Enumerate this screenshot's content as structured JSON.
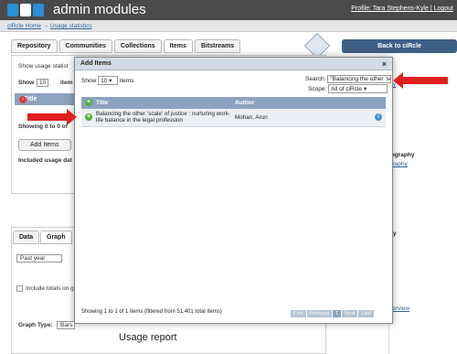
{
  "header": {
    "app_title": "admin modules",
    "profile": "Profile: Tara Stephens-Kyle | Logout"
  },
  "breadcrumb": {
    "home": "ciRcle Home",
    "sep": "→",
    "current": "Usage statistics"
  },
  "tabs": [
    "Repository",
    "Communities",
    "Collections",
    "Items",
    "Bitstreams"
  ],
  "back_button": "Back to ciRcle",
  "background": {
    "show_usage": "Show usage statist",
    "show_label": "Show",
    "show_value": "10",
    "items_label": "item",
    "th_title": "Title",
    "showing": "Showing 0 to 0 of",
    "add_items": "Add Items",
    "included": "Included usage dat",
    "data_tab": "Data",
    "graph_tab": "Graph",
    "past_year": "Past year",
    "include_totals": "Include totals on gr",
    "graph_type_label": "Graph Type:",
    "graph_type_value": "Bars",
    "usage_report": "Usage report",
    "side_bibliography": "iography",
    "side_link1": "graphy",
    "side_link2": "try",
    "side_item1": "n",
    "side_item2": "ity",
    "side_item3": "s",
    "side_item4": "verview"
  },
  "modal": {
    "title": "Add Items",
    "close": "×",
    "show_label": "Show",
    "show_value": "10",
    "items_label": "items",
    "search_label": "Search:",
    "search_value": "\"Balancing the other 'scale' of justice\"",
    "scope_label": "Scope:",
    "scope_value": "All of ciRcle",
    "col_title": "Title",
    "col_author": "Author",
    "rows": [
      {
        "title": "Balancing the other 'scale' of justice : nurturing work-life balance in the legal profession",
        "author": "Mohan, Arun"
      }
    ],
    "footer_info": "Showing 1 to 1 of 1 items (filtered from 51,401 total items)",
    "pager": [
      "First",
      "Previous",
      "1",
      "Next",
      "Last"
    ]
  },
  "colors": {
    "header": "#4a4a4a",
    "accent": "#2a8fd6",
    "table_header": "#8ba3bf",
    "arrow": "#e02020"
  }
}
